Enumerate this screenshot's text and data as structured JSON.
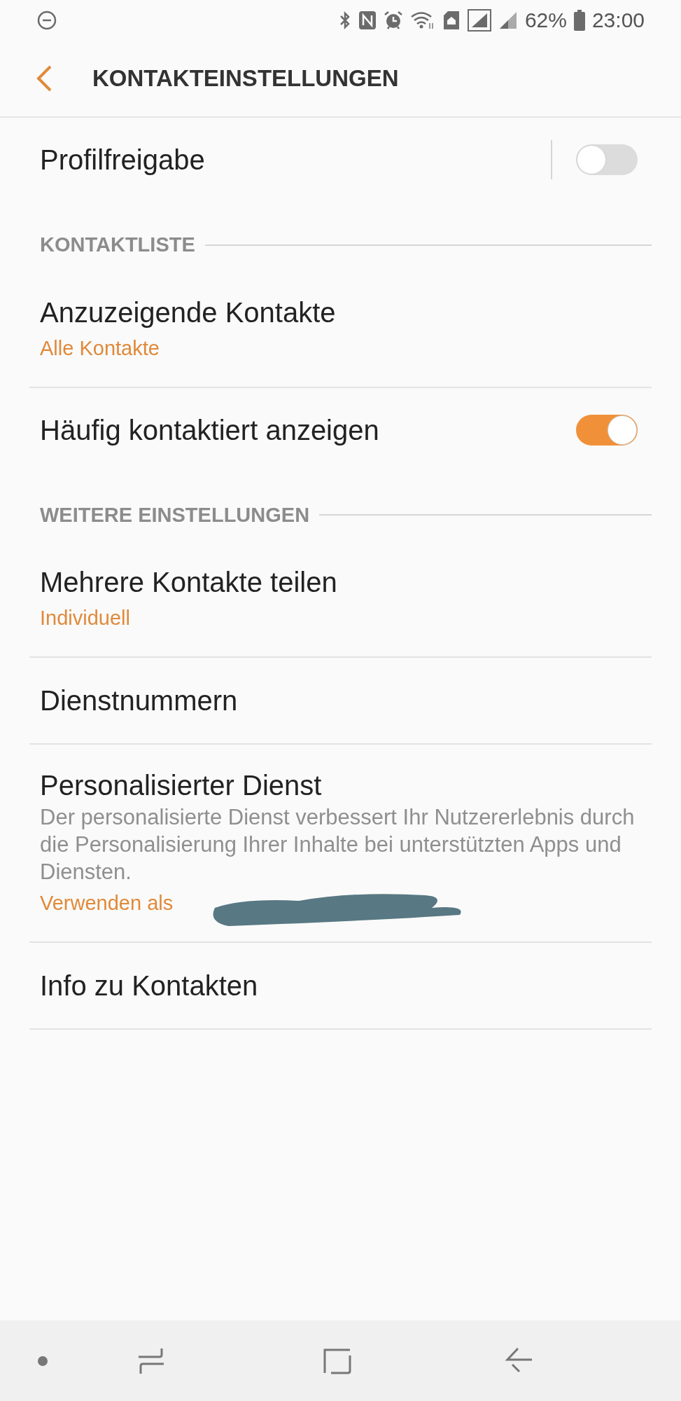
{
  "status_bar": {
    "battery": "62%",
    "time": "23:00"
  },
  "header": {
    "title": "KONTAKTEINSTELLUNGEN"
  },
  "items": [
    {
      "kind": "toggle",
      "title": "Profilfreigabe",
      "on": false,
      "separator": true
    },
    {
      "kind": "section",
      "title": "KONTAKTLISTE"
    },
    {
      "kind": "setting",
      "title": "Anzuzeigende Kontakte",
      "value": "Alle Kontakte"
    },
    {
      "kind": "toggle",
      "title": "Häufig kontaktiert anzeigen",
      "on": true,
      "separator": false
    },
    {
      "kind": "section",
      "title": "WEITERE EINSTELLUNGEN"
    },
    {
      "kind": "setting",
      "title": "Mehrere Kontakte teilen",
      "value": "Individuell"
    },
    {
      "kind": "setting",
      "title": "Dienstnummern"
    },
    {
      "kind": "setting",
      "title": "Personalisierter Dienst",
      "description": "Der personalisierte Dienst verbessert Ihr Nutzererlebnis durch die Personalisierung Ihrer Inhalte bei unterstützten Apps und Diensten.",
      "value": "Verwenden als",
      "redacted": true
    },
    {
      "kind": "setting",
      "title": "Info zu Kontakten"
    }
  ]
}
